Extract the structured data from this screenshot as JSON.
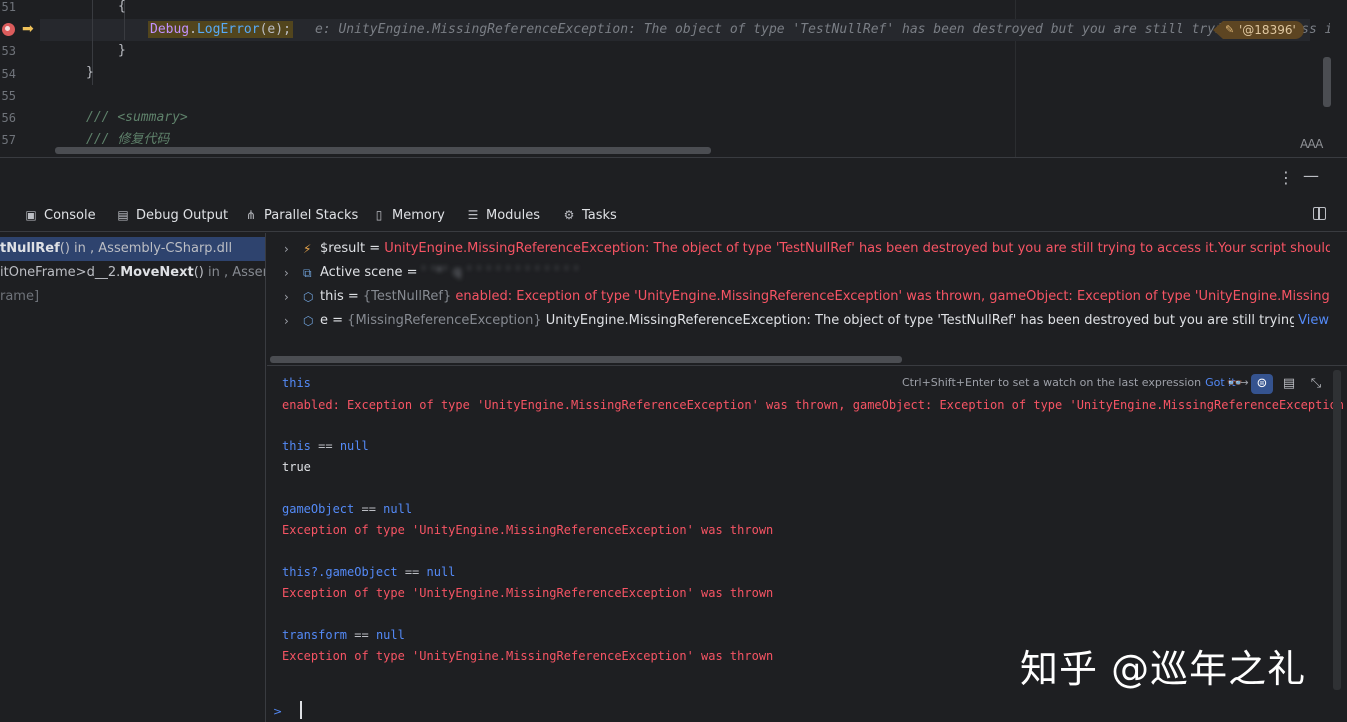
{
  "editor": {
    "line_numbers": [
      "51",
      "53",
      "54",
      "55",
      "56",
      "57"
    ],
    "line_brace_open": "{",
    "stmt_class": "Debug",
    "stmt_dot": ".",
    "stmt_method": "LogError",
    "stmt_args": "(e);",
    "inline_hint": "e: UnityEngine.MissingReferenceException: The object of type 'TestNullRef' has been destroyed but you are still trying to access it.Your script should either check if it",
    "object_badge": "'@18396'",
    "line_close_inner": "}",
    "line_close_outer": "}",
    "line_summary_prefix": "/// ",
    "line_summary_tag": "<summary>",
    "line_comment_prefix": "/// ",
    "line_comment_text": "修复代码",
    "font_size_icon": "AAA"
  },
  "panel": {
    "tabs": [
      {
        "label": "Console",
        "icon": "console-icon"
      },
      {
        "label": "Debug Output",
        "icon": "debug-output-icon"
      },
      {
        "label": "Parallel Stacks",
        "icon": "parallel-stacks-icon"
      },
      {
        "label": "Memory",
        "icon": "memory-icon"
      },
      {
        "label": "Modules",
        "icon": "modules-icon"
      },
      {
        "label": "Tasks",
        "icon": "tasks-icon"
      }
    ]
  },
  "frames": [
    {
      "name": "tNullRef",
      "name_suffix": "()",
      "location": " in , Assembly-CSharp.dll",
      "selected": true
    },
    {
      "prefix": "itOneFrame>d__2.",
      "name": "MoveNext",
      "name_suffix": "()",
      "location": " in , Assembly-C",
      "selected": false
    },
    {
      "prefix": "rame]",
      "selected": false
    }
  ],
  "variables": [
    {
      "name": "$result",
      "eq": " = ",
      "type": "",
      "value": "UnityEngine.MissingReferenceException: The object of type 'TestNullRef' has been destroyed but you are still trying to access it.Your script should either check if it",
      "is_error": true,
      "icon": "result-icon"
    },
    {
      "name": "Active scene",
      "eq": " = ",
      "type": "",
      "value": "' '*' q ' ' ' ' ' ' ' ' ' ' ' '",
      "is_error": false,
      "blurred": true,
      "icon": "scene-icon"
    },
    {
      "name": "this",
      "eq": " = ",
      "type": "{TestNullRef} ",
      "value": "enabled: Exception of type 'UnityEngine.MissingReferenceException' was thrown, gameObject: Exception of type 'UnityEngine.MissingReferenceException'",
      "is_error": true,
      "icon": "object-icon"
    },
    {
      "name": "e",
      "eq": " = ",
      "type": "{MissingReferenceException} ",
      "value": "UnityEngine.MissingReferenceException: The object of type 'TestNullRef' has been destroyed but you are still trying to access it.\\nYour",
      "link": "View",
      "is_error": false,
      "icon": "object-icon"
    }
  ],
  "console": {
    "hint": "Ctrl+Shift+Enter to set a watch on the last expression",
    "got_it": "Got it",
    "entries": [
      {
        "expr_a": "this",
        "op": "",
        "expr_b": "",
        "result": "enabled: Exception of type 'UnityEngine.MissingReferenceException' was thrown, gameObject: Exception of type 'UnityEngine.MissingReferenceException' w",
        "is_error": true
      },
      {
        "expr_a": "this",
        "op": " == ",
        "expr_b": "null",
        "result": "true",
        "is_error": false
      },
      {
        "expr_a": "gameObject",
        "op": " == ",
        "expr_b": "null",
        "result": "Exception of type 'UnityEngine.MissingReferenceException' was thrown",
        "is_error": true
      },
      {
        "expr_a": "this?.gameObject",
        "op": " == ",
        "expr_b": "null",
        "result": "Exception of type 'UnityEngine.MissingReferenceException' was thrown",
        "is_error": true
      },
      {
        "expr_a": "transform",
        "op": " == ",
        "expr_b": "null",
        "result": "Exception of type 'UnityEngine.MissingReferenceException' was thrown",
        "is_error": true
      }
    ],
    "prompt": ">"
  },
  "watermark": "知乎 @巡年之礼",
  "colors": {
    "background": "#1e1f22",
    "error": "#f75464",
    "link": "#548af7",
    "selection": "#2e436e"
  }
}
